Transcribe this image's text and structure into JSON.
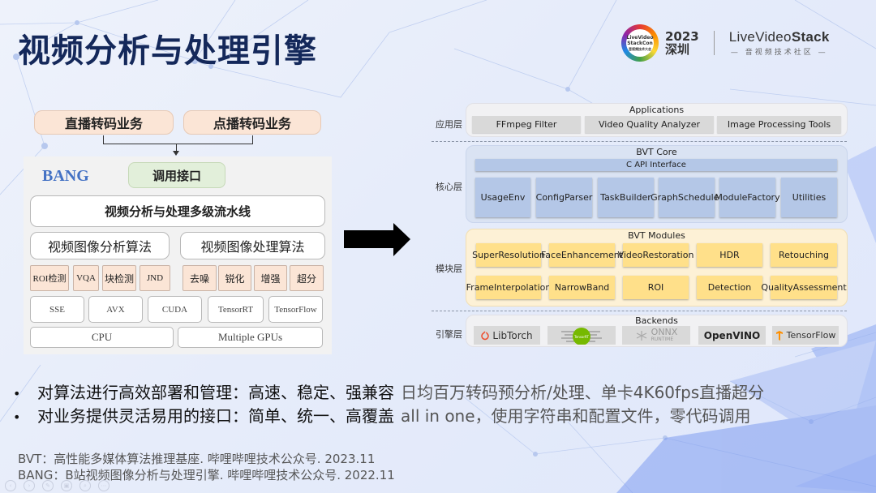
{
  "title": "视频分析与处理引擎",
  "logo": {
    "ring_text": [
      "LiveVideo",
      "StackCon",
      "音视频技术大会"
    ],
    "year": "2023",
    "city": "深圳",
    "brand_prefix": "Live",
    "brand_video": "Video",
    "brand_stack": "Stack",
    "brand_subtitle": "— 音视频技术社区 —"
  },
  "left_diagram": {
    "services": [
      "直播转码业务",
      "点播转码业务"
    ],
    "engine_name": "BANG",
    "api": "调用接口",
    "pipeline": "视频分析与处理多级流水线",
    "algorithm_groups": [
      "视频图像分析算法",
      "视频图像处理算法"
    ],
    "analysis_algorithms": [
      "ROI检测",
      "VQA",
      "块检测",
      "JND"
    ],
    "processing_algorithms": [
      "去噪",
      "锐化",
      "增强",
      "超分"
    ],
    "acceleration": [
      "SSE",
      "AVX",
      "CUDA",
      "TensorRT",
      "TensorFlow"
    ],
    "hardware": [
      "CPU",
      "Multiple GPUs"
    ]
  },
  "right_diagram": {
    "layers": {
      "application": {
        "label": "应用层",
        "title": "Applications",
        "items": [
          "FFmpeg Filter",
          "Video Quality Analyzer",
          "Image Processing Tools"
        ]
      },
      "core": {
        "label": "核心层",
        "title": "BVT Core",
        "interface": "C API Interface",
        "items": [
          [
            "Usage",
            "Env"
          ],
          [
            "Config",
            "Parser"
          ],
          [
            "Task",
            "Builder"
          ],
          [
            "Graph",
            "Scheduler"
          ],
          [
            "Module",
            "Factory"
          ],
          [
            "Utilities",
            ""
          ]
        ]
      },
      "modules": {
        "label": "模块层",
        "title": "BVT Modules",
        "row1": [
          [
            "Super",
            "Resolution"
          ],
          [
            "Face",
            "Enhancement"
          ],
          [
            "Video",
            "Restoration"
          ],
          [
            "HDR",
            ""
          ],
          [
            "Retouching",
            ""
          ]
        ],
        "row2": [
          [
            "Frame",
            "Interpolation"
          ],
          [
            "Narrow",
            "Band"
          ],
          [
            "ROI",
            ""
          ],
          [
            "Detection",
            ""
          ],
          [
            "Quality",
            "Assessment"
          ]
        ]
      },
      "engine": {
        "label": "引擎层",
        "title": "Backends",
        "items": [
          {
            "name": "LibTorch",
            "icon": "pytorch-flame-icon",
            "color": "#ee4c2c"
          },
          {
            "name": "TensorRT",
            "icon": "tensorrt-logo-icon",
            "color": "#76b900"
          },
          {
            "name": "ONNX",
            "sub": "RUNTIME",
            "icon": "onnx-runtime-icon",
            "color": "#9a9a9a"
          },
          {
            "name": "OpenVINO",
            "icon": "openvino-logo-icon",
            "color": "#222222"
          },
          {
            "name": "TensorFlow",
            "icon": "tensorflow-logo-icon",
            "color": "#ff8f00"
          }
        ]
      }
    }
  },
  "bullets": [
    {
      "dot": "•",
      "main": "对算法进行高效部署和管理：高速、稳定、强兼容",
      "note": "日均百万转码预分析/处理、单卡4K60fps直播超分"
    },
    {
      "dot": "•",
      "main": "对业务提供灵活易用的接口：简单、统一、高覆盖",
      "note": "all in one，使用字符串和配置文件，零代码调用"
    }
  ],
  "references": [
    "BVT：高性能多媒体算法推理基座. 哔哩哔哩技术公众号. 2023.11",
    "BANG：B站视频图像分析与处理引擎. 哔哩哔哩技术公众号. 2022.11"
  ],
  "ppt_controls": [
    "‹",
    "›",
    "✎",
    "▣",
    "⌕",
    "⋯"
  ],
  "colors": {
    "title": "#14285a",
    "salmon": "#fbe5d6",
    "green_api": "#e2efda",
    "bang_blue": "#4472c4",
    "core_blue": "#b4c7e7",
    "module_yellow": "#ffe08a",
    "gray_cell": "#d9d9d9"
  }
}
